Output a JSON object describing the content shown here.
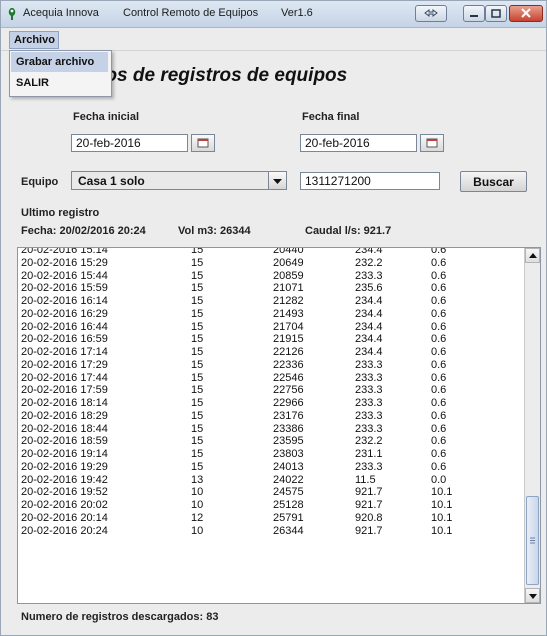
{
  "window": {
    "app_name": "Acequia Innova",
    "title": "Control Remoto de Equipos",
    "version": "Ver1.6"
  },
  "menu": {
    "archivo_label": "Archivo",
    "items": [
      {
        "label": "Grabar archivo"
      },
      {
        "label": "SALIR"
      }
    ]
  },
  "form": {
    "title": "on de datos de registros de equipos",
    "fecha_inicial_label": "Fecha inicial",
    "fecha_inicial_value": "20-feb-2016",
    "fecha_final_label": "Fecha final",
    "fecha_final_value": "20-feb-2016",
    "equipo_label": "Equipo",
    "equipo_selected": "Casa 1 solo",
    "equipo_id": "1311271200",
    "buscar_label": "Buscar"
  },
  "ultimo_registro": {
    "heading": "Ultimo registro",
    "fecha_text": "Fecha: 20/02/2016 20:24",
    "vol_text": "Vol m3:  26344",
    "caudal_text": "Caudal l/s:  921.7"
  },
  "records": [
    [
      "20-02-2016 15:14",
      "15",
      "20440",
      "234.4",
      "0.6"
    ],
    [
      "20-02-2016 15:29",
      "15",
      "20649",
      "232.2",
      "0.6"
    ],
    [
      "20-02-2016 15:44",
      "15",
      "20859",
      "233.3",
      "0.6"
    ],
    [
      "20-02-2016 15:59",
      "15",
      "21071",
      "235.6",
      "0.6"
    ],
    [
      "20-02-2016 16:14",
      "15",
      "21282",
      "234.4",
      "0.6"
    ],
    [
      "20-02-2016 16:29",
      "15",
      "21493",
      "234.4",
      "0.6"
    ],
    [
      "20-02-2016 16:44",
      "15",
      "21704",
      "234.4",
      "0.6"
    ],
    [
      "20-02-2016 16:59",
      "15",
      "21915",
      "234.4",
      "0.6"
    ],
    [
      "20-02-2016 17:14",
      "15",
      "22126",
      "234.4",
      "0.6"
    ],
    [
      "20-02-2016 17:29",
      "15",
      "22336",
      "233.3",
      "0.6"
    ],
    [
      "20-02-2016 17:44",
      "15",
      "22546",
      "233.3",
      "0.6"
    ],
    [
      "20-02-2016 17:59",
      "15",
      "22756",
      "233.3",
      "0.6"
    ],
    [
      "20-02-2016 18:14",
      "15",
      "22966",
      "233.3",
      "0.6"
    ],
    [
      "20-02-2016 18:29",
      "15",
      "23176",
      "233.3",
      "0.6"
    ],
    [
      "20-02-2016 18:44",
      "15",
      "23386",
      "233.3",
      "0.6"
    ],
    [
      "20-02-2016 18:59",
      "15",
      "23595",
      "232.2",
      "0.6"
    ],
    [
      "20-02-2016 19:14",
      "15",
      "23803",
      "231.1",
      "0.6"
    ],
    [
      "20-02-2016 19:29",
      "15",
      "24013",
      "233.3",
      "0.6"
    ],
    [
      "20-02-2016 19:42",
      "13",
      "24022",
      "11.5",
      "0.0"
    ],
    [
      "20-02-2016 19:52",
      "10",
      "24575",
      "921.7",
      "10.1"
    ],
    [
      "20-02-2016 20:02",
      "10",
      "25128",
      "921.7",
      "10.1"
    ],
    [
      "20-02-2016 20:14",
      "12",
      "25791",
      "920.8",
      "10.1"
    ],
    [
      "20-02-2016 20:24",
      "10",
      "26344",
      "921.7",
      "10.1"
    ]
  ],
  "status": {
    "text": "Numero de registros descargados: 83"
  },
  "colors": {
    "menu_highlight": "#c5d1e6",
    "close_button": "#c8432f"
  }
}
